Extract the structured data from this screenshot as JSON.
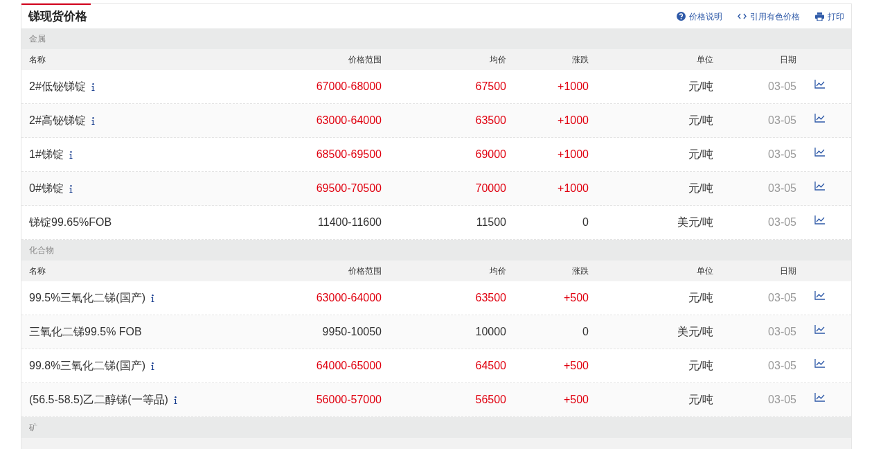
{
  "title": "锑现货价格",
  "actions": [
    {
      "kind": "help",
      "label": "价格说明"
    },
    {
      "kind": "code",
      "label": "引用有色价格"
    },
    {
      "kind": "print",
      "label": "打印"
    }
  ],
  "sections": [
    {
      "name": "金属",
      "columns": [
        "名称",
        "价格范围",
        "均价",
        "涨跌",
        "单位",
        "日期"
      ],
      "rows": [
        {
          "name": "2#低铋锑锭",
          "info": true,
          "rising": true,
          "range": "67000-68000",
          "avg": "67500",
          "change": "+1000",
          "unit": "元/吨",
          "date": "03-05"
        },
        {
          "name": "2#高铋锑锭",
          "info": true,
          "rising": true,
          "range": "63000-64000",
          "avg": "63500",
          "change": "+1000",
          "unit": "元/吨",
          "date": "03-05"
        },
        {
          "name": "1#锑锭",
          "info": true,
          "rising": true,
          "range": "68500-69500",
          "avg": "69000",
          "change": "+1000",
          "unit": "元/吨",
          "date": "03-05"
        },
        {
          "name": "0#锑锭",
          "info": true,
          "rising": true,
          "range": "69500-70500",
          "avg": "70000",
          "change": "+1000",
          "unit": "元/吨",
          "date": "03-05"
        },
        {
          "name": "锑锭99.65%FOB",
          "info": false,
          "rising": false,
          "range": "11400-11600",
          "avg": "11500",
          "change": "0",
          "unit": "美元/吨",
          "date": "03-05"
        }
      ]
    },
    {
      "name": "化合物",
      "columns": [
        "名称",
        "价格范围",
        "均价",
        "涨跌",
        "单位",
        "日期"
      ],
      "rows": [
        {
          "name": "99.5%三氧化二锑(国产)",
          "info": true,
          "rising": true,
          "range": "63000-64000",
          "avg": "63500",
          "change": "+500",
          "unit": "元/吨",
          "date": "03-05"
        },
        {
          "name": "三氧化二锑99.5% FOB",
          "info": false,
          "rising": false,
          "range": "9950-10050",
          "avg": "10000",
          "change": "0",
          "unit": "美元/吨",
          "date": "03-05"
        },
        {
          "name": "99.8%三氧化二锑(国产)",
          "info": true,
          "rising": true,
          "range": "64000-65000",
          "avg": "64500",
          "change": "+500",
          "unit": "元/吨",
          "date": "03-05"
        },
        {
          "name": "(56.5-58.5)乙二醇锑(一等品)",
          "info": true,
          "rising": true,
          "range": "56000-57000",
          "avg": "56500",
          "change": "+500",
          "unit": "元/吨",
          "date": "03-05"
        }
      ]
    },
    {
      "name": "矿"
    }
  ]
}
